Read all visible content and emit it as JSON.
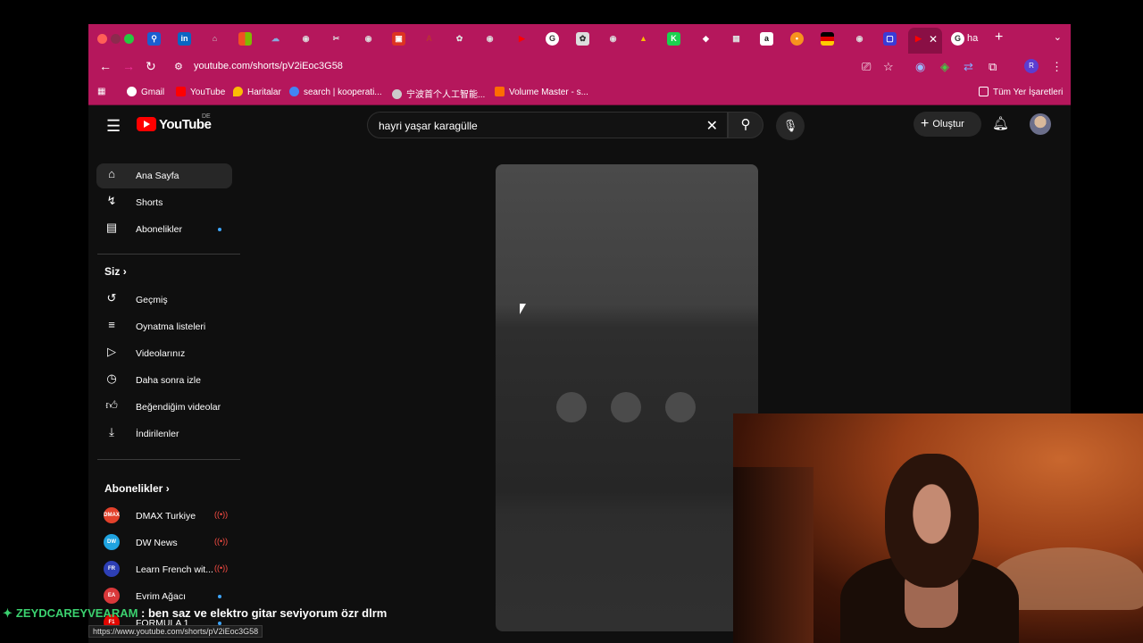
{
  "browser": {
    "active_tab_label": "ha",
    "url": "youtube.com/shorts/pV2iEoc3G58",
    "status_url": "https://www.youtube.com/shorts/pV2iEoc3G58",
    "bookmarks": [
      {
        "label": "Gmail",
        "icon": "gmail-icon",
        "color": "#ea4335"
      },
      {
        "label": "YouTube",
        "icon": "youtube-icon",
        "color": "#ff0000"
      },
      {
        "label": "Haritalar",
        "icon": "maps-icon",
        "color": "#fbbc04"
      },
      {
        "label": "search | kooperati...",
        "icon": "globe-icon",
        "color": "#4285f4"
      },
      {
        "label": "宁波首个人工智能...",
        "icon": "globe-icon",
        "color": "#cccccc"
      },
      {
        "label": "Volume Master - s...",
        "icon": "volume-icon",
        "color": "#ff6d00"
      }
    ],
    "all_bookmarks_label": "Tüm Yer İşaretleri",
    "profile_initial": "R"
  },
  "youtube": {
    "logo_text": "YouTube",
    "country_code": "DE",
    "search_query": "hayri yaşar karagülle",
    "create_label": "Oluştur",
    "nav": [
      {
        "label": "Ana Sayfa",
        "icon": "home-icon"
      },
      {
        "label": "Shorts",
        "icon": "shorts-icon"
      },
      {
        "label": "Abonelikler",
        "icon": "subscriptions-icon"
      }
    ],
    "you_section_title": "Siz",
    "you_items": [
      {
        "label": "Geçmiş",
        "icon": "history-icon"
      },
      {
        "label": "Oynatma listeleri",
        "icon": "playlists-icon"
      },
      {
        "label": "Videolarınız",
        "icon": "your-videos-icon"
      },
      {
        "label": "Daha sonra izle",
        "icon": "watch-later-icon"
      },
      {
        "label": "Beğendiğim videolar",
        "icon": "liked-icon"
      },
      {
        "label": "İndirilenler",
        "icon": "downloads-icon"
      }
    ],
    "subs_section_title": "Abonelikler",
    "subscriptions": [
      {
        "label": "DMAX Turkiye",
        "avatar_text": "DMAX",
        "avatar_color": "#e2412b",
        "indicator": "live"
      },
      {
        "label": "DW News",
        "avatar_text": "DW",
        "avatar_color": "#1fa3e0",
        "indicator": "live"
      },
      {
        "label": "Learn French wit...",
        "avatar_text": "FR",
        "avatar_color": "#2d3fb5",
        "indicator": "live"
      },
      {
        "label": "Evrim Ağacı",
        "avatar_text": "EA",
        "avatar_color": "#d9383a",
        "indicator": "dot"
      },
      {
        "label": "FORMULA 1",
        "avatar_text": "F1",
        "avatar_color": "#e10600",
        "indicator": "dot"
      }
    ]
  },
  "chat": {
    "username": "ZEYDCAREYVEARAM",
    "message": ": ben saz ve elektro gitar seviyorum özr dlrm"
  }
}
